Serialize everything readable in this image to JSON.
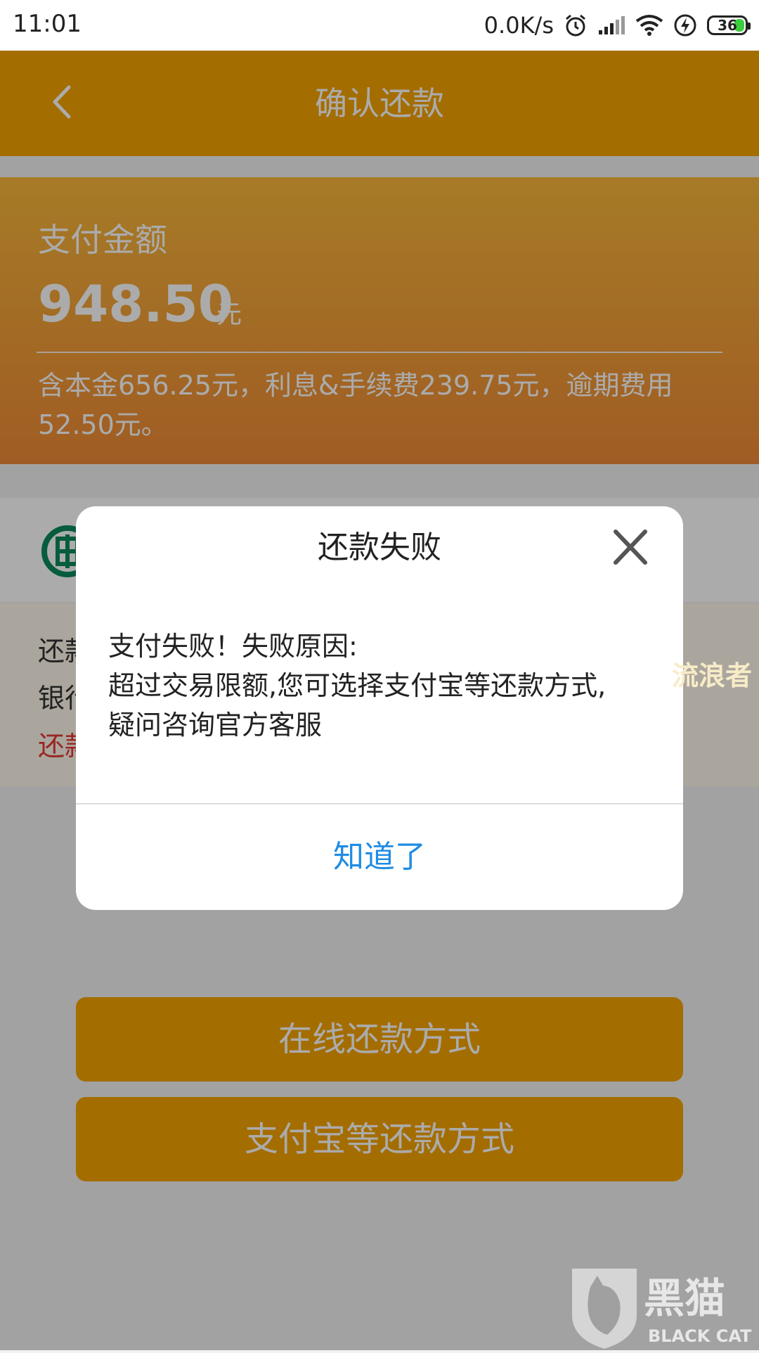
{
  "status_bar": {
    "time": "11:01",
    "net_speed": "0.0K/s",
    "battery": "36"
  },
  "header": {
    "title": "确认还款",
    "back_icon": "chevron-left-icon"
  },
  "amount_card": {
    "label": "支付金额",
    "amount": "948.50",
    "unit": "元",
    "detail": "含本金656.25元，利息&手续费239.75元，逾期费用52.50元。"
  },
  "bank": {
    "logo_icon": "bank-logo-icon"
  },
  "notice": {
    "line1": "还款",
    "line2": "银行",
    "line3": "还款"
  },
  "buttons": {
    "online": "在线还款方式",
    "alipay": "支付宝等还款方式"
  },
  "dialog": {
    "title": "还款失败",
    "line1": "支付失败！失败原因:",
    "line2": "超过交易限额,您可选择支付宝等还款方式,",
    "line3": "疑问咨询官方客服",
    "ok_label": "知道了",
    "close_icon": "close-icon"
  },
  "watermark": {
    "text": "流浪者",
    "logo_main": "黑猫",
    "logo_sub": "BLACK CAT"
  },
  "colors": {
    "accent": "#f5a300",
    "link": "#1f8ce3",
    "warning": "#e53935"
  }
}
